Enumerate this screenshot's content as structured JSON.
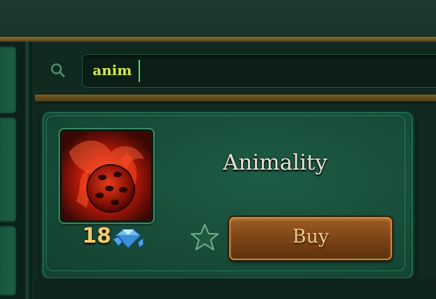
{
  "search": {
    "value": "anim"
  },
  "item": {
    "name": "Animality",
    "price": "18"
  },
  "buttons": {
    "buy_label": "Buy"
  },
  "icons": {
    "search": "search-icon",
    "currency": "gem-icon",
    "favorite": "star-icon",
    "item": "animality-item-icon"
  },
  "colors": {
    "search_text": "#d8e94a",
    "price_text": "#f3c96a",
    "buy_button": "#7a4216",
    "gold_trim": "#8a6a2c"
  }
}
